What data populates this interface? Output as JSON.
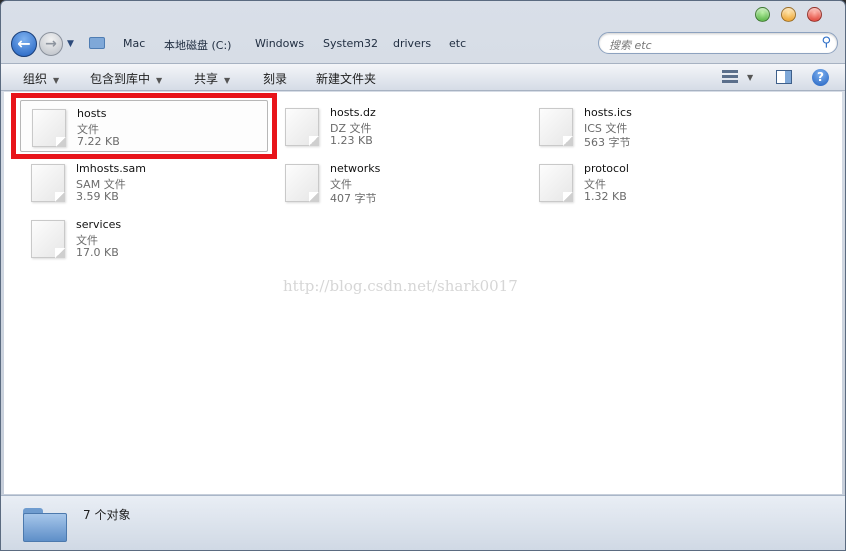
{
  "breadcrumb": [
    "Mac",
    "本地磁盘 (C:)",
    "Windows",
    "System32",
    "drivers",
    "etc"
  ],
  "search": {
    "placeholder": "搜索 etc"
  },
  "toolbar": {
    "organize": "组织",
    "include_library": "包含到库中",
    "share": "共享",
    "burn": "刻录",
    "new_folder": "新建文件夹"
  },
  "files": [
    {
      "name": "hosts",
      "type": "文件",
      "size": "7.22 KB",
      "selected": true
    },
    {
      "name": "hosts.dz",
      "type": "DZ 文件",
      "size": "1.23 KB"
    },
    {
      "name": "hosts.ics",
      "type": "ICS 文件",
      "size": "563 字节"
    },
    {
      "name": "lmhosts.sam",
      "type": "SAM 文件",
      "size": "3.59 KB"
    },
    {
      "name": "networks",
      "type": "文件",
      "size": "407 字节"
    },
    {
      "name": "protocol",
      "type": "文件",
      "size": "1.32 KB"
    },
    {
      "name": "services",
      "type": "文件",
      "size": "17.0 KB"
    }
  ],
  "watermark": "http://blog.csdn.net/shark0017",
  "status": {
    "count_text": "7 个对象"
  },
  "colors": {
    "highlight": "#e8141a",
    "accent": "#1f5fbf"
  }
}
